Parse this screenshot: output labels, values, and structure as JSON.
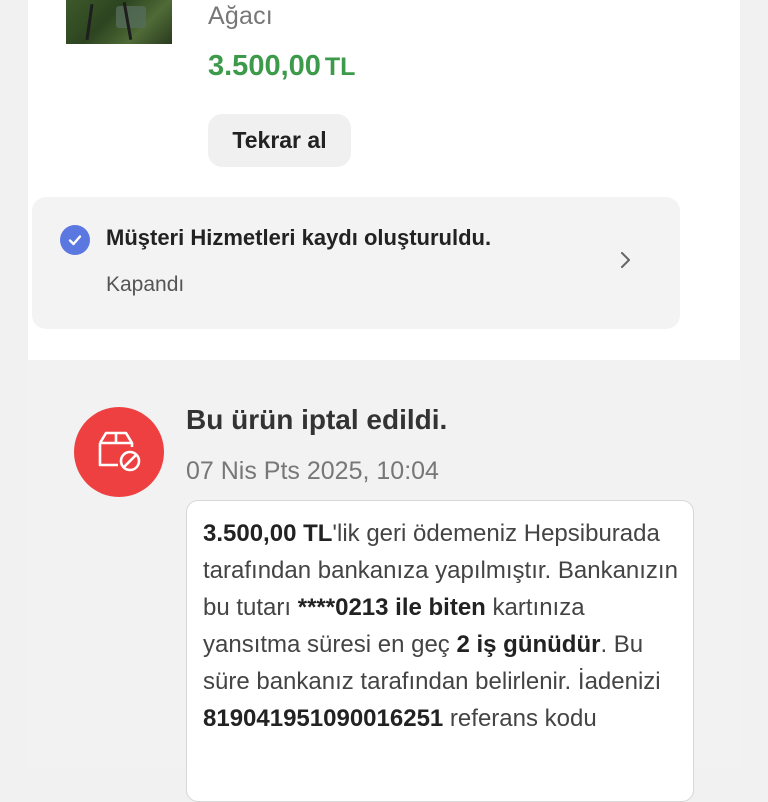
{
  "product": {
    "name_tail": "Ağacı",
    "price_amount": "3.500,00",
    "price_currency": "TL",
    "rebuy_label": "Tekrar al",
    "price_color": "#3c9a4a"
  },
  "support_ticket": {
    "title": "Müşteri Hizmetleri kaydı oluşturuldu.",
    "status": "Kapandı",
    "icon": "check-circle-icon",
    "icon_color": "#5b78e0"
  },
  "cancellation": {
    "title": "Bu ürün iptal edildi.",
    "date": "07 Nis Pts 2025, 10:04",
    "icon": "cancelled-box-icon",
    "icon_color": "#ee4040",
    "refund": {
      "amount": "3.500,00 TL",
      "t1": "'lik geri ödemeniz Hepsiburada tarafından bankanıza yapılmıştır. Bankanızın bu tutarı ",
      "card": "****0213 ile biten",
      "t2": " kartınıza yansıtma süresi en geç ",
      "days": "2 iş günüdür",
      "t3": ". Bu süre bankanız tarafından belirlenir. İadenizi ",
      "reference": "819041951090016251",
      "t4": " referans kodu"
    }
  }
}
